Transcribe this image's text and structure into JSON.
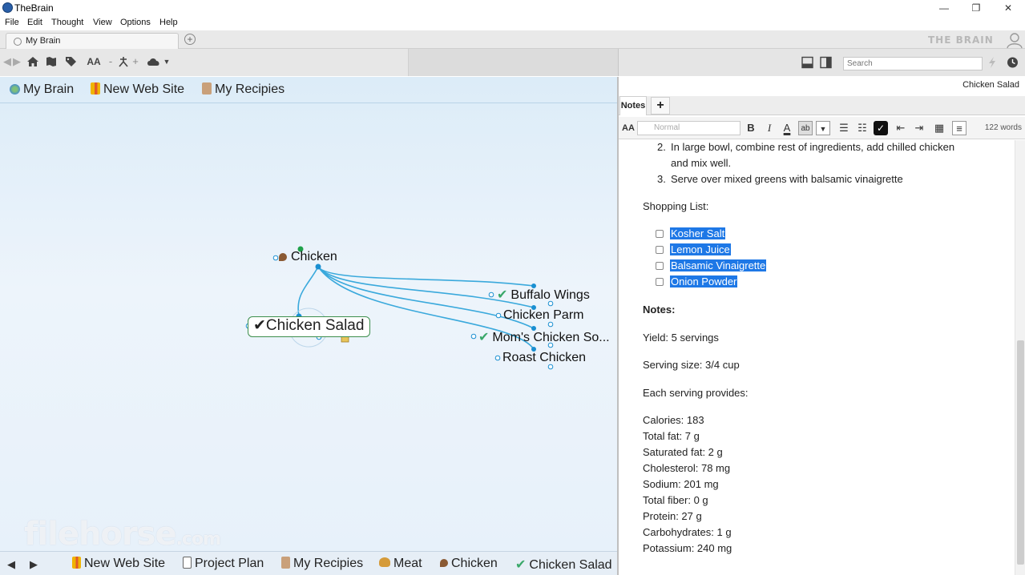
{
  "window": {
    "title": "TheBrain",
    "controls": {
      "minimize": "—",
      "restore": "❐",
      "close": "✕"
    }
  },
  "menu": [
    "File",
    "Edit",
    "Thought",
    "View",
    "Options",
    "Help"
  ],
  "tabs": {
    "active": "My Brain",
    "add_icon": "+"
  },
  "brand": {
    "logo_text": "THE BRAIN"
  },
  "toolbar": {
    "search_placeholder": "Search",
    "font_size_label": "AA"
  },
  "pins": [
    {
      "label": "My Brain",
      "icon": "globe-icon"
    },
    {
      "label": "New Web Site",
      "icon": "pencils-icon"
    },
    {
      "label": "My Recipies",
      "icon": "recipe-icon"
    }
  ],
  "plex": {
    "parent": "Chicken",
    "active": "Chicken Salad",
    "siblings": [
      "Buffalo Wings",
      "Chicken Parm",
      "Mom's Chicken So...",
      "Roast Chicken"
    ]
  },
  "watermark": {
    "text": "filehorse",
    "suffix": ".com"
  },
  "history": {
    "items": [
      {
        "label": "New Web Site"
      },
      {
        "label": "Project Plan"
      },
      {
        "label": "My Recipies"
      },
      {
        "label": "Meat"
      },
      {
        "label": "Chicken"
      },
      {
        "label": "Chicken Salad"
      }
    ]
  },
  "notes": {
    "thought_title": "Chicken Salad",
    "tab_label": "Notes",
    "add_tab": "+",
    "format": {
      "style_placeholder": "Normal",
      "bold": "B",
      "italic": "I",
      "word_count": "122 words"
    },
    "steps": [
      {
        "num": "2.",
        "lines": [
          "In large bowl, combine rest of ingredients, add chilled chicken",
          "and mix well."
        ]
      },
      {
        "num": "3.",
        "lines": [
          "Serve over mixed greens with balsamic vinaigrette"
        ]
      }
    ],
    "shopping_heading": "Shopping List:",
    "shopping_items": [
      "Kosher Salt",
      "Lemon Juice",
      "Balsamic Vinaigrette",
      "Onion Powder"
    ],
    "notes_heading": "Notes:",
    "yield": "Yield: 5 servings",
    "serving_size": "Serving size: 3/4 cup",
    "each_serving": "Each serving provides:",
    "nutrition": [
      "Calories: 183",
      "Total fat: 7 g",
      "Saturated fat: 2 g",
      "Cholesterol: 78 mg",
      "Sodium: 201 mg",
      "Total fiber: 0 g",
      "Protein: 27 g",
      "Carbohydrates: 1 g",
      "Potassium: 240 mg"
    ]
  }
}
